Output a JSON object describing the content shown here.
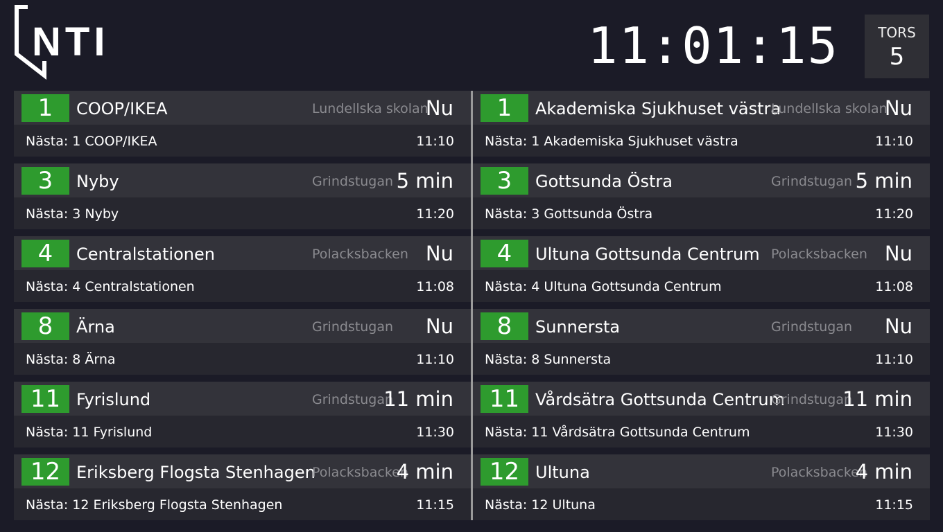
{
  "header": {
    "logo_text": "NTI",
    "clock": "11:01:15",
    "day_name": "TORS",
    "day_number": "5"
  },
  "colors": {
    "background": "#1b1b27",
    "card_top": "#33333a",
    "card_bottom": "#27272f",
    "line_badge": "#2e9b2e",
    "stop_text": "#8a8a8f"
  },
  "left": [
    {
      "line": "1",
      "destination": "COOP/IKEA",
      "stop": "Lundellska skolan",
      "eta": "Nu",
      "next_label": "Nästa: 1 COOP/IKEA",
      "next_time": "11:10"
    },
    {
      "line": "3",
      "destination": "Nyby",
      "stop": "Grindstugan",
      "eta": "5 min",
      "next_label": "Nästa: 3 Nyby",
      "next_time": "11:20"
    },
    {
      "line": "4",
      "destination": "Centralstationen",
      "stop": "Polacksbacken",
      "eta": "Nu",
      "next_label": "Nästa: 4 Centralstationen",
      "next_time": "11:08"
    },
    {
      "line": "8",
      "destination": "Ärna",
      "stop": "Grindstugan",
      "eta": "Nu",
      "next_label": "Nästa: 8 Ärna",
      "next_time": "11:10"
    },
    {
      "line": "11",
      "destination": "Fyrislund",
      "stop": "Grindstugan",
      "eta": "11 min",
      "next_label": "Nästa: 11 Fyrislund",
      "next_time": "11:30"
    },
    {
      "line": "12",
      "destination": "Eriksberg Flogsta Stenhagen",
      "stop": "Polacksbacken",
      "eta": "4 min",
      "next_label": "Nästa: 12 Eriksberg Flogsta Stenhagen",
      "next_time": "11:15"
    }
  ],
  "right": [
    {
      "line": "1",
      "destination": "Akademiska Sjukhuset västra",
      "stop": "Lundellska skolan",
      "eta": "Nu",
      "next_label": "Nästa: 1 Akademiska Sjukhuset västra",
      "next_time": "11:10"
    },
    {
      "line": "3",
      "destination": "Gottsunda Östra",
      "stop": "Grindstugan",
      "eta": "5 min",
      "next_label": "Nästa: 3 Gottsunda Östra",
      "next_time": "11:20"
    },
    {
      "line": "4",
      "destination": "Ultuna Gottsunda Centrum",
      "stop": "Polacksbacken",
      "eta": "Nu",
      "next_label": "Nästa: 4 Ultuna Gottsunda Centrum",
      "next_time": "11:08"
    },
    {
      "line": "8",
      "destination": "Sunnersta",
      "stop": "Grindstugan",
      "eta": "Nu",
      "next_label": "Nästa: 8 Sunnersta",
      "next_time": "11:10"
    },
    {
      "line": "11",
      "destination": "Vårdsätra Gottsunda Centrum",
      "stop": "Grindstugan",
      "eta": "11 min",
      "next_label": "Nästa: 11 Vårdsätra Gottsunda Centrum",
      "next_time": "11:30"
    },
    {
      "line": "12",
      "destination": "Ultuna",
      "stop": "Polacksbacken",
      "eta": "4 min",
      "next_label": "Nästa: 12 Ultuna",
      "next_time": "11:15"
    }
  ]
}
